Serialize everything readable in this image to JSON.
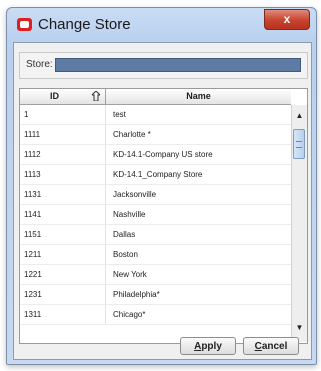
{
  "window": {
    "title": "Change Store",
    "close_label": "x"
  },
  "store_filter": {
    "label": "Store:",
    "value": ""
  },
  "grid": {
    "columns": [
      "ID",
      "Name"
    ],
    "rows": [
      {
        "id": "1",
        "name": "test"
      },
      {
        "id": "1111",
        "name": "Charlotte *"
      },
      {
        "id": "1112",
        "name": "KD-14.1-Company US store"
      },
      {
        "id": "1113",
        "name": "KD-14.1_Company Store"
      },
      {
        "id": "1131",
        "name": "Jacksonville"
      },
      {
        "id": "1141",
        "name": "Nashville"
      },
      {
        "id": "1151",
        "name": "Dallas"
      },
      {
        "id": "1211",
        "name": "Boston"
      },
      {
        "id": "1221",
        "name": "New York"
      },
      {
        "id": "1231",
        "name": "Philadelphia*"
      },
      {
        "id": "1311",
        "name": "Chicago*"
      }
    ]
  },
  "buttons": {
    "apply_accel": "A",
    "apply_rest": "pply",
    "cancel_accel": "C",
    "cancel_rest": "ancel"
  },
  "icons": {
    "app": "app-icon",
    "sort": "sort-icon",
    "scroll_up": "scroll-up-icon",
    "scroll_down": "scroll-down-icon"
  },
  "colors": {
    "titlebar": "#b9d0ee",
    "close_button": "#c7432d",
    "store_input": "#5e7ca3"
  }
}
